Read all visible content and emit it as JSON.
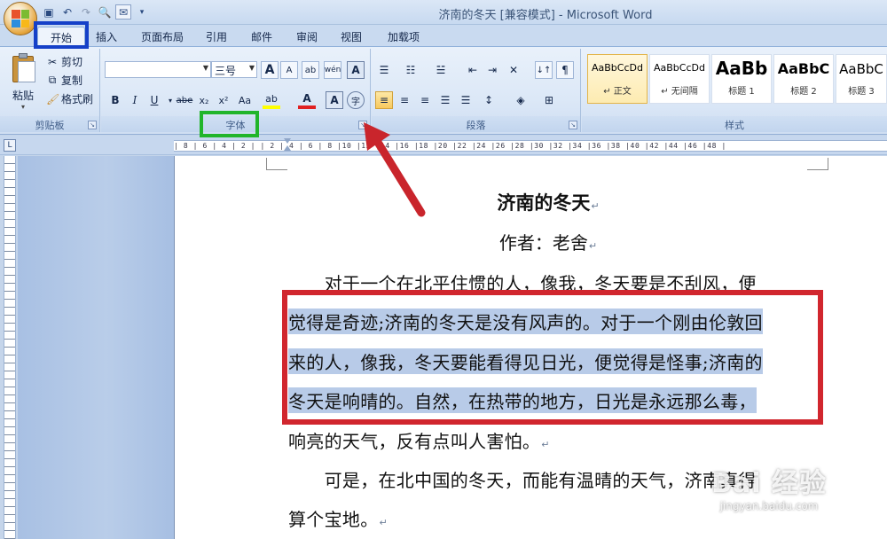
{
  "window": {
    "title": "济南的冬天 [兼容模式] - Microsoft Word"
  },
  "tabs": [
    {
      "label": "开始",
      "active": true
    },
    {
      "label": "插入"
    },
    {
      "label": "页面布局"
    },
    {
      "label": "引用"
    },
    {
      "label": "邮件"
    },
    {
      "label": "审阅"
    },
    {
      "label": "视图"
    },
    {
      "label": "加载项"
    }
  ],
  "clipboard": {
    "paste_label": "粘贴",
    "cut_label": "剪切",
    "copy_label": "复制",
    "format_painter_label": "格式刷",
    "group_label": "剪贴板"
  },
  "font": {
    "font_name": "",
    "font_size": "三号",
    "group_label": "字体",
    "buttons": {
      "grow": "A",
      "shrink": "A",
      "clear": "ab",
      "phonetic": "wén",
      "border": "A",
      "bold": "B",
      "italic": "I",
      "underline": "U",
      "strike": "abe",
      "subscript": "x₂",
      "superscript": "x²",
      "case": "Aa",
      "highlight": "ab",
      "color": "A",
      "shading": "A",
      "enclose": "字"
    }
  },
  "paragraph": {
    "group_label": "段落"
  },
  "styles": {
    "group_label": "样式",
    "items": [
      {
        "sample": "AaBbCcDd",
        "name": "↵ 正文",
        "selected": true
      },
      {
        "sample": "AaBbCcDd",
        "name": "↵ 无间隔"
      },
      {
        "sample": "AaBb",
        "name": "标题 1"
      },
      {
        "sample": "AaBbC",
        "name": "标题 2"
      },
      {
        "sample": "AaBbC",
        "name": "标题 3"
      }
    ]
  },
  "ruler": {
    "corner": "L",
    "ticks": "  | 8 | 6 | 4 | 2 |   | 2 | 4 | 6 | 8 |10 |12 |14 |16 |18 |20 |22 |24 |26 |28 |30 |32 |34 |36 |38 |40 |42 |44 |46 |48 |"
  },
  "document": {
    "title": "济南的冬天",
    "author": "作者：老舍",
    "para_mark": "↵",
    "lines": [
      {
        "text": "　　对于一个在北平住惯的人，像我，冬天要是不刮风，便",
        "selected": false
      },
      {
        "text": "觉得是奇迹;济南的冬天是没有风声的。对于一个刚由伦敦回",
        "selected": true
      },
      {
        "text": "来的人，像我，冬天要能看得见日光，便觉得是怪事;济南的",
        "selected": true
      },
      {
        "text": "冬天是响晴的。自然，在热带的地方，日光是永远那么毒，",
        "selected": true
      },
      {
        "text": "响亮的天气，反有点叫人害怕。",
        "selected": false,
        "mark": true
      },
      {
        "text": "　　可是，在北中国的冬天，而能有温晴的天气，济南真得",
        "selected": false
      },
      {
        "text": "算个宝地。",
        "selected": false,
        "mark": true
      }
    ]
  },
  "watermark": {
    "main": "Bai 经验",
    "sub": "jingyan.baidu.com"
  },
  "colors": {
    "highlight_blue": "#1540c8",
    "highlight_green": "#21b52a",
    "highlight_red": "#d1262e",
    "selection": "#b8cbe8"
  }
}
